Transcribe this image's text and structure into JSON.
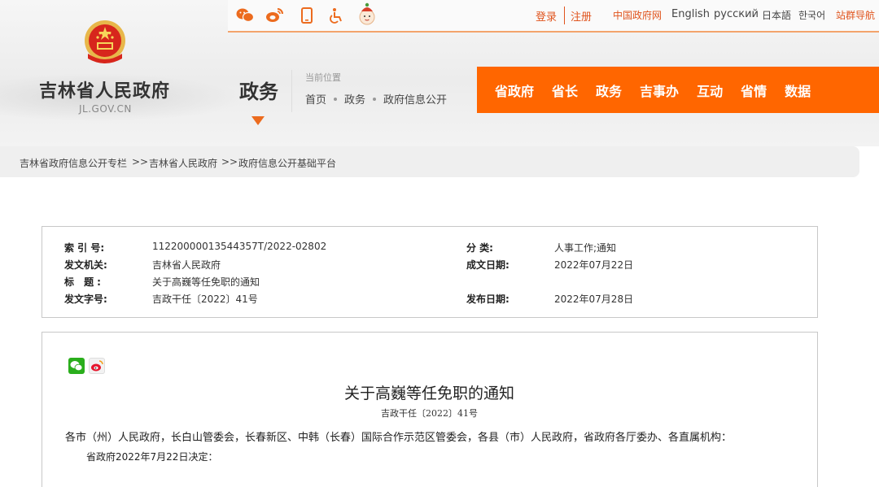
{
  "top_bar": {
    "icons": [
      "wechat-icon",
      "weibo-icon",
      "mobile-icon",
      "accessibility-icon",
      "mascot-icon"
    ],
    "login": "登录",
    "register": "注册",
    "links": [
      "中国政府网",
      "English",
      "русский",
      "日本語",
      "한국어",
      "站群导航"
    ]
  },
  "header": {
    "site_name": "吉林省人民政府",
    "site_domain": "JL.GOV.CN",
    "section_title": "政务",
    "location_label": "当前位置",
    "location_trail": [
      "首页",
      "政务",
      "政府信息公开"
    ]
  },
  "main_nav": [
    "省政府",
    "省长",
    "政务",
    "吉事办",
    "互动",
    "省情",
    "数据"
  ],
  "breadcrumb": [
    "吉林省政府信息公开专栏",
    ">>",
    "吉林省人民政府",
    ">>",
    "政府信息公开基础平台"
  ],
  "info": {
    "index_label": "索 引 号:",
    "index_value": "11220000013544357T/2022-02802",
    "category_label": "分 类:",
    "category_value": "人事工作;通知",
    "issuer_label": "发文机关:",
    "issuer_value": "吉林省人民政府",
    "date_label": "成文日期:",
    "date_value": "2022年07月22日",
    "title_label": "标 题:",
    "title_value": "关于高巍等任免职的通知",
    "docno_label": "发文字号:",
    "docno_value": "吉政干任〔2022〕41号",
    "publish_label": "发布日期:",
    "publish_value": "2022年07月28日"
  },
  "article": {
    "title": "关于高巍等任免职的通知",
    "doc_number": "吉政干任〔2022〕41号",
    "recipients": "各市（州）人民政府，长白山管委会，长春新区、中韩（长春）国际合作示范区管委会，各县（市）人民政府，省政府各厅委办、各直属机构：",
    "line1": "省政府2022年7月22日决定："
  },
  "colors": {
    "accent": "#ff6600",
    "link_red": "#e0541d"
  }
}
